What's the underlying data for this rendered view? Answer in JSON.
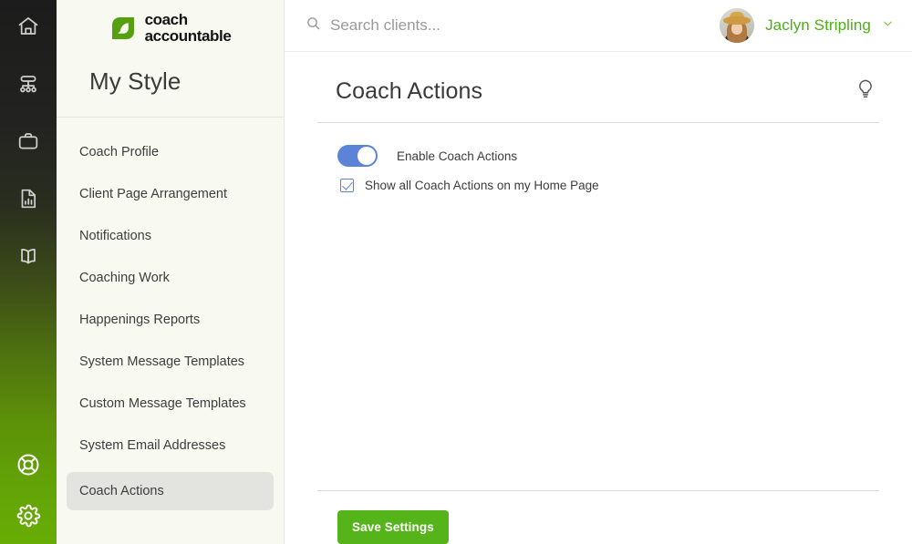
{
  "rail": {
    "top_icons": [
      {
        "name": "home-icon",
        "title": "Home"
      },
      {
        "name": "org-chart-icon",
        "title": "Teams"
      },
      {
        "name": "briefcase-icon",
        "title": "Work"
      },
      {
        "name": "report-file-icon",
        "title": "Reports"
      },
      {
        "name": "book-icon",
        "title": "Library"
      }
    ],
    "bottom_icons": [
      {
        "name": "life-ring-icon",
        "title": "Help"
      },
      {
        "name": "gear-icon",
        "title": "Settings"
      }
    ],
    "gradient_top": "#1c1c1c",
    "gradient_bottom": "#67ad05"
  },
  "sidebar": {
    "brand": {
      "line1": "coach",
      "line2": "accountable",
      "mark_color": "#56a010"
    },
    "heading": "My Style",
    "items": [
      {
        "label": "Coach Profile",
        "active": false
      },
      {
        "label": "Client Page Arrangement",
        "active": false
      },
      {
        "label": "Notifications",
        "active": false
      },
      {
        "label": "Coaching Work",
        "active": false
      },
      {
        "label": "Happenings Reports",
        "active": false
      },
      {
        "label": "System Message Templates",
        "active": false
      },
      {
        "label": "Custom Message Templates",
        "active": false
      },
      {
        "label": "System Email Addresses",
        "active": false
      },
      {
        "label": "Coach Actions",
        "active": true
      }
    ],
    "background": "#f8f9f1",
    "active_background": "#e3e4e0"
  },
  "topbar": {
    "search": {
      "placeholder": "Search clients...",
      "value": "",
      "icon": "search-icon"
    },
    "user": {
      "name": "Jaclyn Stripling",
      "name_color": "#4caf17",
      "chevron": "chevron-down-icon"
    }
  },
  "page": {
    "title": "Coach Actions",
    "hint_icon": "lightbulb-icon"
  },
  "settings": {
    "toggle": {
      "label": "Enable Coach Actions",
      "state": "on",
      "on_color": "#5b83d8"
    },
    "checkbox": {
      "label": "Show all Coach Actions on my Home Page",
      "checked": true,
      "accent_color": "#5b83d8"
    }
  },
  "footer": {
    "save_label": "Save Settings",
    "save_color": "#55b41a"
  }
}
